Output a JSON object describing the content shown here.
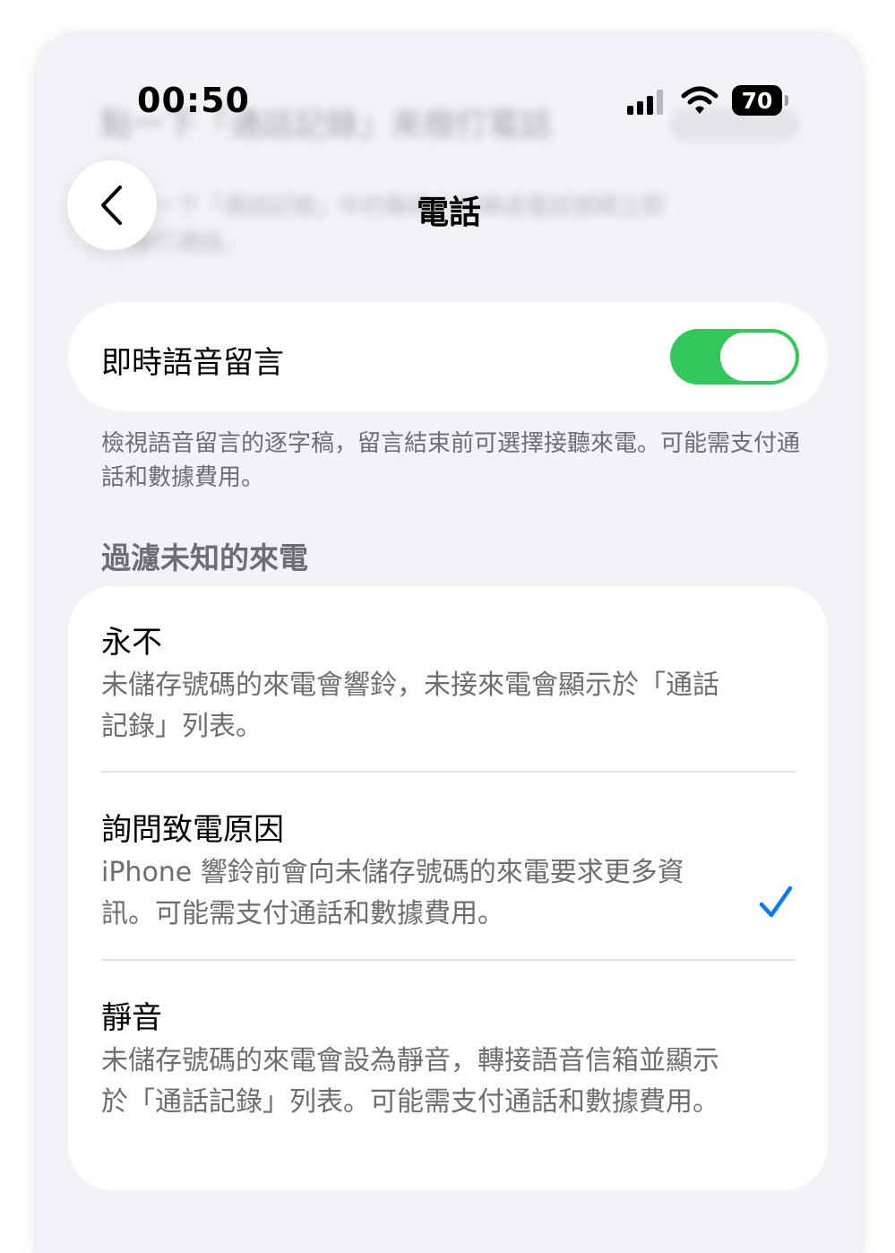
{
  "status_bar": {
    "time": "00:50",
    "battery": "70",
    "signal_icon": "cellular-signal-icon",
    "wifi_icon": "wifi-icon"
  },
  "nav": {
    "title": "電話",
    "back_icon": "chevron-left-icon"
  },
  "live_voicemail": {
    "label": "即時語音留言",
    "enabled": true,
    "footnote": "檢視語音留言的逐字稿，留言結束前可選擇接聽來電。可能需支付通話和數據費用。"
  },
  "screen_unknown": {
    "header": "過濾未知的來電",
    "options": [
      {
        "title": "永不",
        "description": "未儲存號碼的來電會響鈴，未接來電會顯示於「通話記錄」列表。",
        "selected": false
      },
      {
        "title": "詢問致電原因",
        "description": "iPhone 響鈴前會向未儲存號碼的來電要求更多資訊。可能需支付通話和數據費用。",
        "selected": true
      },
      {
        "title": "靜音",
        "description": "未儲存號碼的來電會設為靜音，轉接語音信箱並顯示於「通話記錄」列表。可能需支付通話和數據費用。",
        "selected": false
      }
    ]
  },
  "colors": {
    "accent": "#007aff",
    "toggle_on": "#34c759",
    "background": "#f2f2f7",
    "secondary_text": "#6d6d72"
  }
}
